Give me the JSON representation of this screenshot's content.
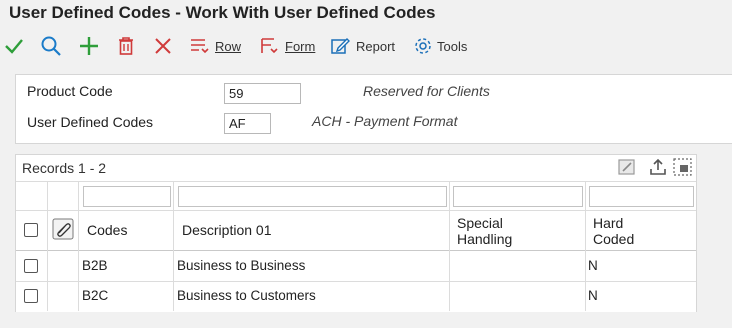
{
  "window": {
    "title": "User Defined Codes - Work With User Defined Codes"
  },
  "toolbar": {
    "row_label": "Row",
    "form_label": "Form",
    "report_label": "Report",
    "tools_label": "Tools",
    "colors": {
      "ok": "#2e9e3a",
      "search": "#1a7bc9",
      "add": "#2e9e3a",
      "delete": "#d03a3a",
      "cancel": "#d03a3a",
      "menu": "#d03a3a",
      "report": "#1a6fb8"
    }
  },
  "header": {
    "product_code_label": "Product Code",
    "product_code_value": "59",
    "product_code_desc": "Reserved for Clients",
    "udc_label": "User Defined Codes",
    "udc_value": "AF",
    "udc_desc": "ACH - Payment Format"
  },
  "grid": {
    "records_label": "Records 1 - 2",
    "columns": {
      "codes": "Codes",
      "description": "Description 01",
      "special_1": "Special",
      "special_2": "Handling",
      "hard_1": "Hard",
      "hard_2": "Coded"
    },
    "rows": [
      {
        "code": "B2B",
        "description": "Business to Business",
        "special": "",
        "hard_coded": "N"
      },
      {
        "code": "B2C",
        "description": "Business to Customers",
        "special": "",
        "hard_coded": "N"
      }
    ]
  }
}
